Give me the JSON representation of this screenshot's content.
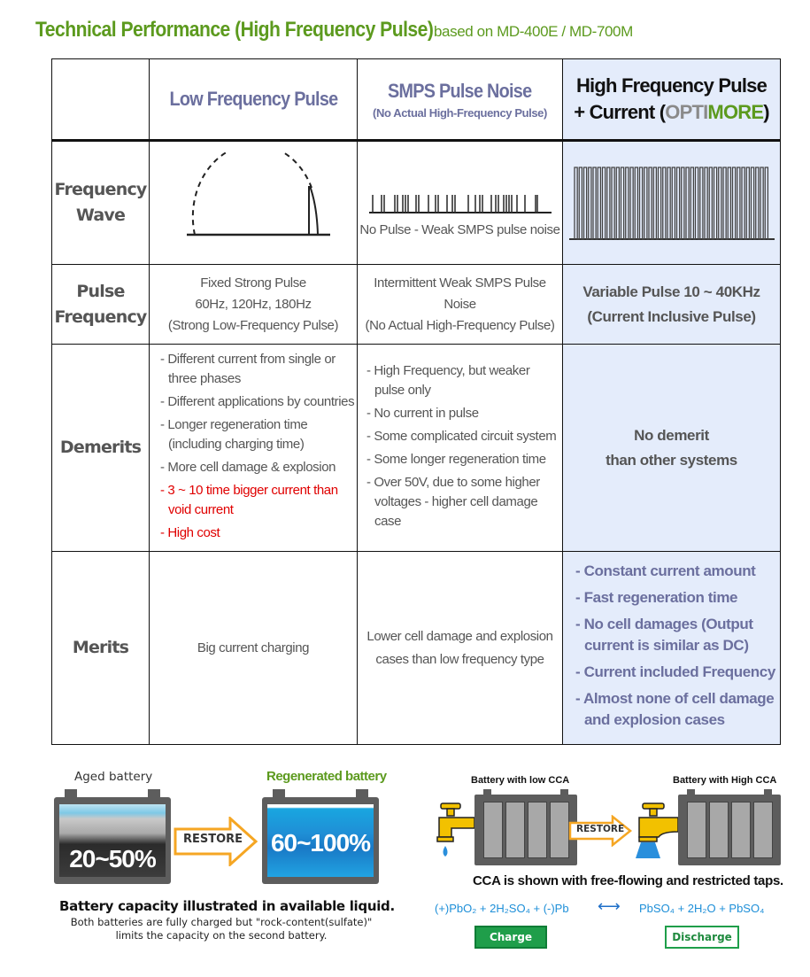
{
  "title": {
    "main": "Technical Performance (High Frequency Pulse)",
    "sub": "based on MD-400E / MD-700M"
  },
  "table": {
    "columns": [
      {
        "title": "Low Frequency Pulse"
      },
      {
        "title": "SMPS Pulse Noise",
        "subtitle": "(No Actual High-Frequency Pulse)"
      },
      {
        "title_line1": "High Frequency Pulse",
        "title_line2_prefix": "+ Current (",
        "brand_part1": "OPTI",
        "brand_part2": "MORE",
        "title_line2_suffix": ")"
      }
    ],
    "rows": {
      "frequency_wave": {
        "label_line1": "Frequency",
        "label_line2": "Wave",
        "smps_caption": "No Pulse - Weak SMPS pulse noise"
      },
      "pulse_frequency": {
        "label_line1": "Pulse",
        "label_line2": "Frequency",
        "low": [
          "Fixed Strong Pulse",
          "60Hz, 120Hz, 180Hz",
          "(Strong Low-Frequency Pulse)"
        ],
        "smps": [
          "Intermittent Weak SMPS Pulse Noise",
          "(No Actual High-Frequency Pulse)"
        ],
        "high": [
          "Variable Pulse 10 ~ 40KHz",
          "(Current Inclusive Pulse)"
        ]
      },
      "demerits": {
        "label": "Demerits",
        "low": [
          {
            "text": "- Different current from single or three phases",
            "highlight": false
          },
          {
            "text": "- Different applications by countries",
            "highlight": false
          },
          {
            "text": "- Longer regeneration time (including charging time)",
            "highlight": false
          },
          {
            "text": "- More cell damage & explosion",
            "highlight": false
          },
          {
            "text": "- 3 ~ 10 time bigger current than void current",
            "highlight": true
          },
          {
            "text": "- High cost",
            "highlight": true
          }
        ],
        "smps": [
          "- High Frequency, but weaker pulse only",
          "- No current in pulse",
          "- Some complicated circuit system",
          "- Some longer regeneration time",
          "- Over 50V, due to some higher voltages - higher cell damage case"
        ],
        "high": [
          "No demerit",
          "than other systems"
        ]
      },
      "merits": {
        "label": "Merits",
        "low": "Big current charging",
        "smps": [
          "Lower cell damage and explosion",
          "cases than low frequency type"
        ],
        "high": [
          "- Constant current amount",
          "- Fast regeneration time",
          "- No cell damages (Output current is similar as DC)",
          "- Current included Frequency",
          "- Almost none of cell damage and explosion cases"
        ]
      }
    }
  },
  "capacity_illustration": {
    "aged_label": "Aged battery",
    "aged_value": "20~50%",
    "regen_label": "Regenerated battery",
    "regen_value": "60~100%",
    "arrow_label": "RESTORE",
    "caption": "Battery capacity illustrated in available liquid.",
    "note_line1": "Both batteries are fully charged but \"rock-content(sulfate)\"",
    "note_line2": "limits the capacity on the second battery."
  },
  "cca_illustration": {
    "low_label": "Battery with low CCA",
    "high_label": "Battery with High CCA",
    "arrow_label": "RESTORE",
    "caption": "CCA is shown with free-flowing and restricted taps.",
    "equation_left": "(+)PbO₂ + 2H₂SO₄  + (-)Pb",
    "equation_arrow": "⟷",
    "equation_right": "PbSO₄  + 2H₂O + PbSO₄",
    "charge_label": "Charge",
    "discharge_label": "Discharge"
  },
  "colors": {
    "title_green": "#5c9a1e",
    "purple_text": "#6b6f9e",
    "highlight_bg": "#e4ecfb",
    "red_text": "#e00000",
    "equation_blue": "#1e8fd8",
    "charge_green": "#1f9e4a",
    "arrow_orange": "#f5a623"
  }
}
